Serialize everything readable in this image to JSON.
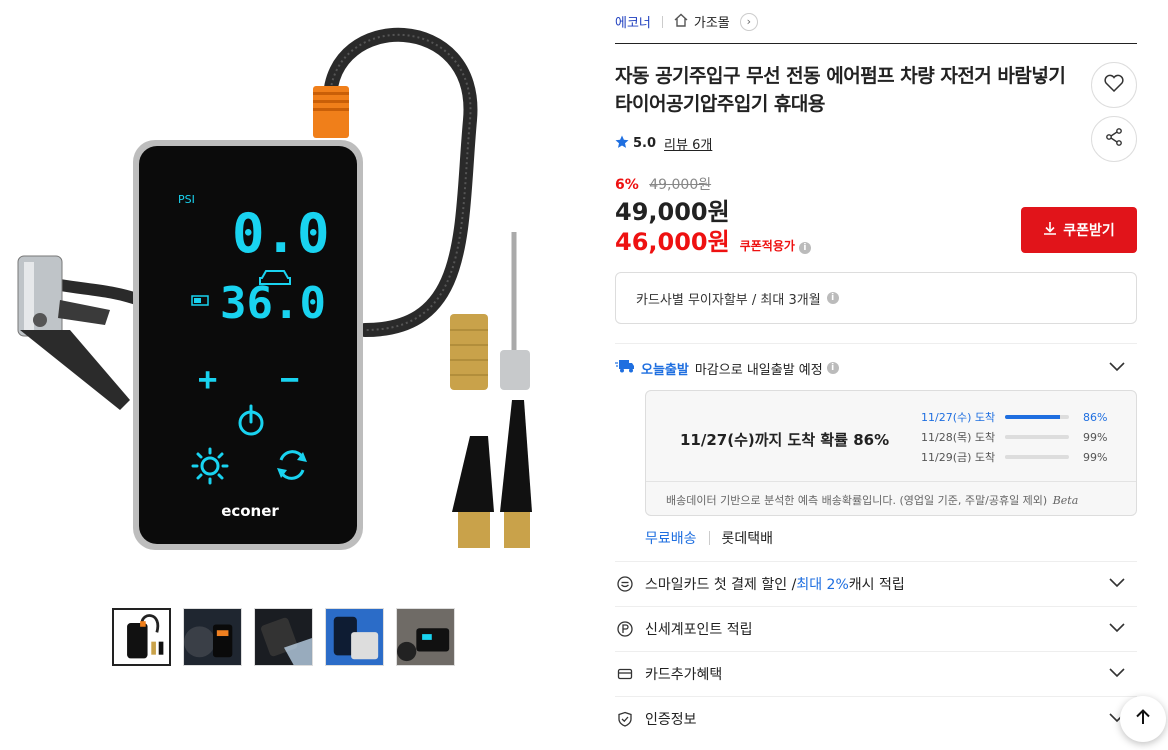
{
  "breadcrumb": {
    "brand": "에코너",
    "category": "가조몰"
  },
  "product": {
    "title": "자동 공기주입구 무선 전동 에어펌프 차량 자전거 바람넣기 타이어공기압주입기 휴대용",
    "rating": "5.0",
    "review_label": "리뷰 6개",
    "discount_pct": "6%",
    "original_price": "49,000원",
    "price": "49,000원",
    "coupon_price": "46,000원",
    "coupon_tag": "쿠폰적용가",
    "coupon_button": "쿠폰받기"
  },
  "device_display": {
    "unit": "PSI",
    "reading_top": "0.0",
    "reading_bottom": "36.0",
    "plus": "+",
    "minus": "−",
    "brand": "econer"
  },
  "installment": {
    "text": "카드사별 무이자할부 / 최대 3개월"
  },
  "shipping": {
    "badge": "오늘출발",
    "description": "마감으로 내일출발 예정",
    "headline": "11/27(수)까지 도착 확률 86%",
    "rows": [
      {
        "label": "11/27(수) 도착",
        "value": "86%",
        "fill": 0.86
      },
      {
        "label": "11/28(목) 도착",
        "value": "99%",
        "fill": 0.99
      },
      {
        "label": "11/29(금) 도착",
        "value": "99%",
        "fill": 0.99
      }
    ],
    "note": "배송데이터 기반으로 분석한 예측 배송확률입니다. (영업일 기준, 주말/공휴일 제외)",
    "note_beta": "Beta",
    "free": "무료배송",
    "carrier": "롯데택배"
  },
  "benefits": {
    "smile_prefix": "스마일카드 첫 결제 할인 / ",
    "smile_highlight": "최대 2%",
    "smile_suffix": " 캐시 적립",
    "point": "신세계포인트 적립",
    "card": "카드추가혜택",
    "cert": "인증정보"
  },
  "colors": {
    "accent_blue": "#1f6fe0",
    "sale_red": "#e1141a",
    "lcd_cyan": "#19d3f0"
  }
}
